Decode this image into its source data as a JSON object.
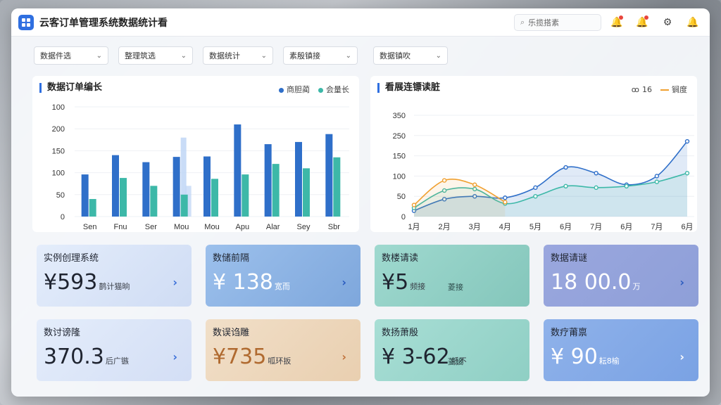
{
  "app": {
    "title": "云客订单管理系统数据统计看"
  },
  "topbar": {
    "search_placeholder": "乐揽搭素",
    "icons": [
      "bell-icon",
      "bell-alert-icon",
      "settings-icon",
      "notification-icon"
    ]
  },
  "filters": [
    {
      "label": "数据件选"
    },
    {
      "label": "整理筑选"
    },
    {
      "label": "数据统计"
    },
    {
      "label": "素殷镇接"
    },
    {
      "label": "数据镇吹"
    }
  ],
  "bar_panel": {
    "title": "数据订单编长",
    "legend": [
      {
        "name": "商胆蔺",
        "color": "#2f6fc9"
      },
      {
        "name": "会量长",
        "color": "#3db8a8"
      }
    ]
  },
  "line_panel": {
    "title": "看展连镖读脏",
    "legend": [
      {
        "name": "16",
        "icon": "chart-icon"
      },
      {
        "name": "锏度",
        "color": "#f0a030"
      }
    ]
  },
  "chart_data": [
    {
      "type": "bar",
      "categories": [
        "Sen",
        "Fnu",
        "Ser",
        "Mou",
        "Mou",
        "Apu",
        "Alar",
        "Sey",
        "Sbr"
      ],
      "ylim": [
        0,
        250
      ],
      "yticks": [
        0,
        50,
        100,
        150,
        200,
        100
      ],
      "series": [
        {
          "name": "商胆蔺",
          "color": "#2f6fc9",
          "values": [
            96,
            140,
            124,
            136,
            137,
            210,
            165,
            170,
            188
          ]
        },
        {
          "name": "会量长",
          "color": "#3db8a8",
          "values": [
            40,
            88,
            70,
            50,
            86,
            96,
            120,
            110,
            135
          ]
        }
      ],
      "ghost_bar": {
        "index": 3,
        "values": [
          180,
          70
        ]
      }
    },
    {
      "type": "line",
      "categories": [
        "1月",
        "2月",
        "3月",
        "4月",
        "5月",
        "6月",
        "7月",
        "6月",
        "7月",
        "6月"
      ],
      "ylim": [
        0,
        350
      ],
      "yticks": [
        0,
        50,
        100,
        150,
        250,
        350
      ],
      "series": [
        {
          "name": "蓝线",
          "color": "#2f6fc9",
          "values": [
            20,
            60,
            70,
            65,
            100,
            170,
            150,
            110,
            140,
            260
          ]
        },
        {
          "name": "锏度",
          "color": "#3db8a8",
          "values": [
            30,
            90,
            95,
            45,
            70,
            105,
            100,
            105,
            120,
            150
          ]
        },
        {
          "name": "橙线",
          "color": "#f0a030",
          "values": [
            40,
            125,
            110,
            50,
            60,
            100,
            100,
            105,
            120,
            150
          ]
        }
      ]
    }
  ],
  "cards": [
    {
      "title": "实例创理系统",
      "value": "¥593",
      "sub": "鹊计猫晌",
      "extra": ""
    },
    {
      "title": "数储前隔",
      "value": "¥ 138",
      "sub": "宽而",
      "extra": ""
    },
    {
      "title": "数楼请读",
      "value": "¥5",
      "sub": "频接",
      "extra": "菱接"
    },
    {
      "title": "数据请谜",
      "value": "18 00.0",
      "sub": "万",
      "extra": ""
    },
    {
      "title": "数讨谤隆",
      "value": "370.3",
      "sub": "后广镞",
      "extra": ""
    },
    {
      "title": "数误诌雕",
      "value": "¥735",
      "sub": "呱环扳",
      "extra": ""
    },
    {
      "title": "数扬萧殷",
      "value": "¥ 3-62",
      "sub": "纸不",
      "extra": "菱接"
    },
    {
      "title": "数疗莆禀",
      "value": "¥ 90",
      "sub": "耘8榆",
      "extra": ""
    }
  ],
  "colors": {
    "accent": "#2f6fe0",
    "bar_blue": "#2f6fc9",
    "bar_teal": "#3db8a8"
  }
}
